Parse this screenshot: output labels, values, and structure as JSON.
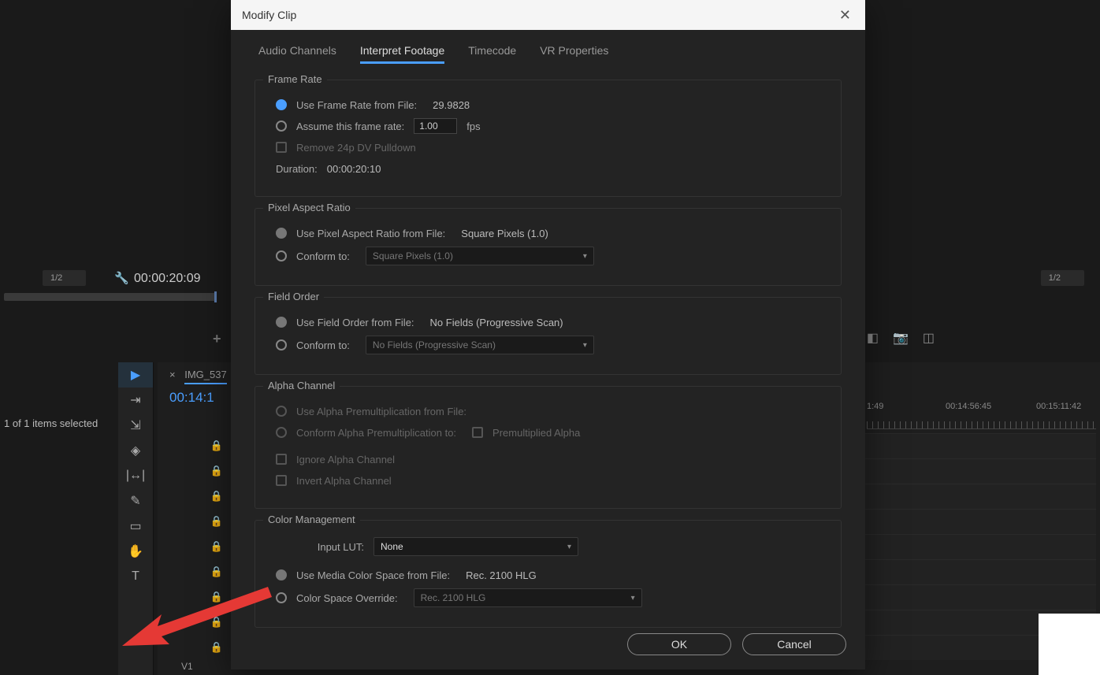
{
  "background": {
    "timecode_left": "00:00:20:09",
    "half_label": "1/2",
    "items_selected": "1 of 1 items selected",
    "sequence_tab": "IMG_537",
    "sequence_time": "00:14:1",
    "ruler": {
      "t1": "1:49",
      "t2": "00:14:56:45",
      "t3": "00:15:11:42"
    },
    "v1_label": "V1"
  },
  "dialog": {
    "title": "Modify Clip",
    "tabs": {
      "audio": "Audio Channels",
      "interpret": "Interpret Footage",
      "timecode": "Timecode",
      "vr": "VR Properties"
    },
    "frame_rate": {
      "section": "Frame Rate",
      "use_file": "Use Frame Rate from File:",
      "use_file_value": "29.9828",
      "assume": "Assume this frame rate:",
      "assume_value": "1.00",
      "fps": "fps",
      "remove_pulldown": "Remove 24p DV Pulldown",
      "duration_label": "Duration:",
      "duration_value": "00:00:20:10"
    },
    "par": {
      "section": "Pixel Aspect Ratio",
      "use_file": "Use Pixel Aspect Ratio from File:",
      "use_file_value": "Square Pixels (1.0)",
      "conform": "Conform to:",
      "conform_value": "Square Pixels (1.0)"
    },
    "field": {
      "section": "Field Order",
      "use_file": "Use Field Order from File:",
      "use_file_value": "No Fields (Progressive Scan)",
      "conform": "Conform to:",
      "conform_value": "No Fields (Progressive Scan)"
    },
    "alpha": {
      "section": "Alpha Channel",
      "use_file": "Use Alpha Premultiplication from File:",
      "conform": "Conform Alpha Premultiplication to:",
      "premult": "Premultiplied Alpha",
      "ignore": "Ignore Alpha Channel",
      "invert": "Invert Alpha Channel"
    },
    "color": {
      "section": "Color Management",
      "input_lut": "Input LUT:",
      "input_lut_value": "None",
      "use_file": "Use Media Color Space from File:",
      "use_file_value": "Rec. 2100 HLG",
      "override": "Color Space Override:",
      "override_value": "Rec. 2100 HLG"
    },
    "buttons": {
      "ok": "OK",
      "cancel": "Cancel"
    }
  }
}
